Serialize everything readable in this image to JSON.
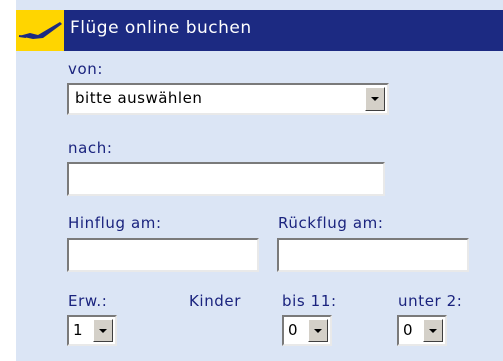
{
  "header": {
    "title": "Flüge online buchen",
    "icon": "airplane-icon"
  },
  "from": {
    "label": "von:",
    "value": "bitte auswählen"
  },
  "to": {
    "label": "nach:",
    "value": ""
  },
  "outbound": {
    "label": "Hinflug am:",
    "value": ""
  },
  "return": {
    "label": "Rückflug am:",
    "value": ""
  },
  "passengers": {
    "adults_label": "Erw.:",
    "children_label": "Kinder",
    "under11_label": "bis 11:",
    "under2_label": "unter 2:",
    "adults_value": "1",
    "under11_value": "0",
    "under2_value": "0"
  },
  "colors": {
    "header_bg": "#1c2a82",
    "panel_bg": "#dbe5f5",
    "accent": "#ffd500",
    "label_text": "#1a237e"
  }
}
